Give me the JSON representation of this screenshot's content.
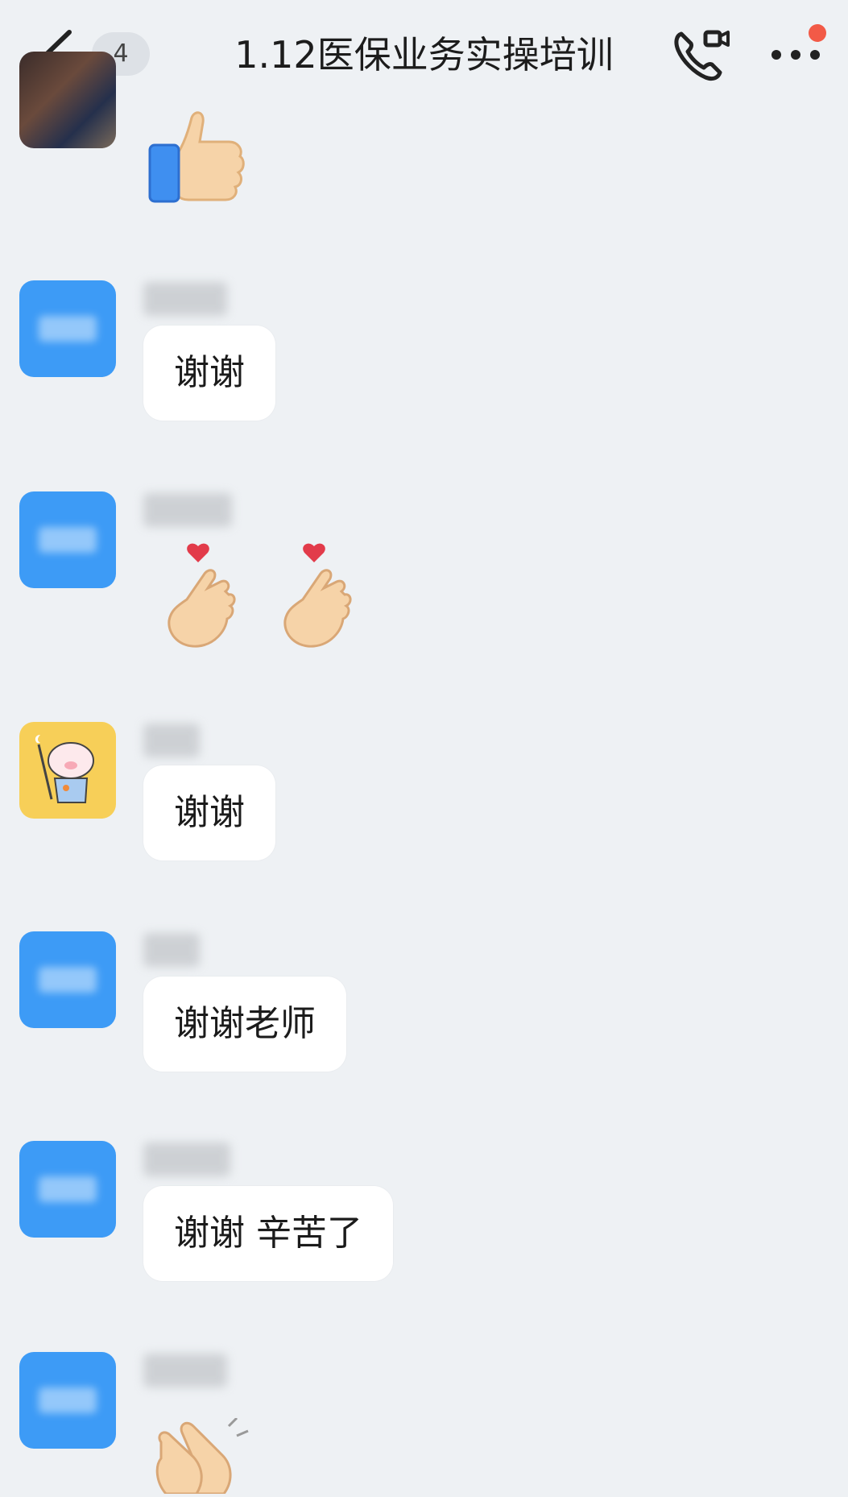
{
  "header": {
    "unread_count": "4",
    "title": "1.12医保业务实操培训"
  },
  "icons": {
    "back": "chevron-left-icon",
    "call": "phone-video-icon",
    "more": "more-dots-icon",
    "thumbs_up": "thumbs-up-emoji",
    "finger_heart": "finger-heart-emoji",
    "clap": "clapping-hands-emoji"
  },
  "colors": {
    "background": "#eef1f4",
    "avatar_blue": "#3d9bf6",
    "avatar_yellow": "#f7cf58",
    "notification_dot": "#f25a47",
    "bubble": "#ffffff"
  },
  "messages": [
    {
      "type": "emoji",
      "emoji": "thumbs-up"
    },
    {
      "type": "text",
      "text": "谢谢"
    },
    {
      "type": "emoji",
      "emoji": "finger-heart"
    },
    {
      "type": "text",
      "text": "谢谢"
    },
    {
      "type": "text",
      "text": "谢谢老师"
    },
    {
      "type": "text",
      "text": "谢谢 辛苦了"
    },
    {
      "type": "emoji",
      "emoji": "clap"
    }
  ]
}
